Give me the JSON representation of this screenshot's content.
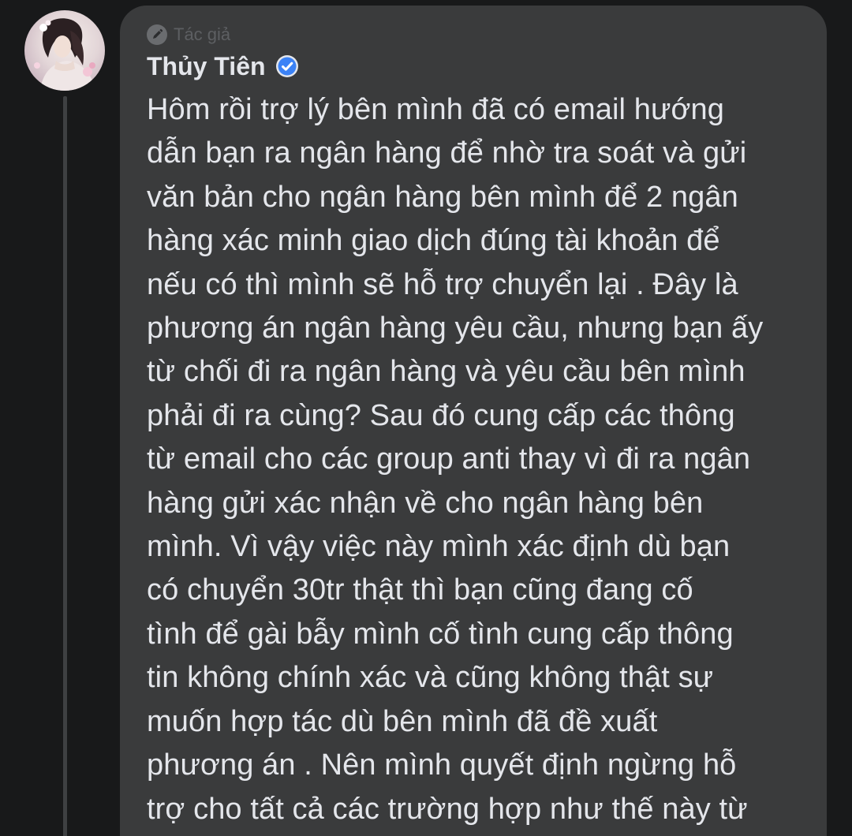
{
  "comment": {
    "author_badge_label": "Tác giả",
    "author_badge_icon": "pen-icon",
    "author_name": "Thủy Tiên",
    "verified_icon": "verified-badge-icon",
    "verified_color": "#3b82f6",
    "text": "Hôm rồi trợ lý bên mình đã có email hướng\ndẫn bạn ra ngân hàng để nhờ tra soát và gửi\nvăn bản cho ngân hàng bên mình để 2 ngân\nhàng xác minh giao dịch đúng tài khoản để\nnếu có thì mình sẽ hỗ trợ chuyển lại . Đây là\nphương án ngân hàng yêu cầu, nhưng bạn ấy\ntừ chối đi ra ngân hàng và yêu cầu bên mình\nphải đi ra cùng? Sau đó cung cấp các thông\ntừ email cho các group anti thay vì đi ra ngân\nhàng gửi xác nhận về cho ngân hàng bên\nmình. Vì vậy việc này mình xác định dù bạn\ncó chuyển 30tr thật thì bạn cũng đang cố\ntình để gài bẫy mình cố tình cung cấp thông\ntin không chính xác và cũng không thật sự\nmuốn hợp tác dù bên mình đã đề xuất\nphương án . Nên mình quyết định ngừng hỗ\ntrợ cho tất cả các trường hợp như thế này từ\nđây về sau nhé."
  },
  "theme": {
    "background": "#18191a",
    "bubble": "#3a3b3c",
    "text": "#e4e6eb",
    "muted": "#5d5f62"
  }
}
